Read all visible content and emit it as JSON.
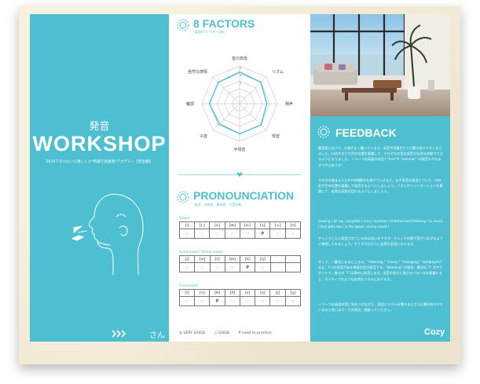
{
  "panel1": {
    "subtitle": "発音",
    "title": "WORKSHOP",
    "description": "2024アタルたいに達しくさ*特選で高金詞*アカデミー【完全版】",
    "student_suffix": "さん"
  },
  "factors": {
    "title": "8 FACTORS",
    "subtitle": "-発音8ファクター分析",
    "labels": [
      "音の高低",
      "リズム",
      "発声",
      "母音",
      "半母音",
      "子音",
      "輪郭",
      "自然な感情"
    ],
    "inner_scale": [
      "5",
      "4",
      "3"
    ],
    "values": [
      4.2,
      4,
      3.6,
      4,
      4,
      3.8,
      4,
      4
    ]
  },
  "pronunciation": {
    "title": "PRONOUNCIATION",
    "subtitle": "-母音、半母音、鼻母音、子音分析",
    "tables": [
      {
        "label": "Vowel",
        "headers": [
          "[ɪ]",
          "[iː]",
          "[e]",
          "[æ]",
          "[ɑ:]",
          "[ʌ]",
          "[ɔ:]",
          "[ʊ]"
        ],
        "marks": [
          "○",
          "○",
          "○",
          "○",
          "○",
          "P",
          "○",
          "○"
        ]
      },
      {
        "label": "Semivowel / Nasal vowel",
        "headers": [
          "[j]",
          "[w]",
          "[r]",
          "[m]",
          "[n]",
          "[ŋ]"
        ],
        "marks": [
          "○",
          "○",
          "○",
          "○",
          "P",
          "○"
        ]
      },
      {
        "label": "Consonant",
        "headers": [
          "[f]",
          "[v]",
          "[θ]",
          "[ð]",
          "[s]",
          "[z]",
          "[ʃ]",
          "[ʒ]"
        ],
        "marks": [
          "○",
          "○",
          "P",
          "○",
          "○",
          "○",
          "○",
          "○"
        ]
      }
    ],
    "legend": {
      "very_good": "◎ VERY GOOD",
      "good": "○ GOOD",
      "practice": "P need to practice"
    }
  },
  "feedback": {
    "title": "FEEDBACK",
    "paragraphs": [
      "擬音語と比べて、口角がよく動いています。母音や音量がとても聞き取りやすくなりました。口の大きさや舌の位置を意識して、それぞれの音の発音が自然な状態でできるようになりました。一つ一つの英語の発音で\"line\"や \"summer\" の発音もやわまずで大丈夫です！",
      "その点を踏まえ2,3,4での問題点を挙げていきます。まず母音の発音について、口の形や舌の位置を意識して発音するようにしましょう。リズムやイントネーションを意識して、自然な英語を話せるようにしましょう。",
      "making / all my / playlists / very / summer / themed and listening / to music / that gets me / in the good / sunny mood /",
      "チャンクごとに発音されているのは良いのですが、チャンクの間で音がつながるように練習してみましょう。そうすればさらに自然な英語になります。",
      "そして、一番気になるところは、\"listening,\" \"music,\" \"changing,\" \"wallpapers\" など、2つの母音がある単語の音の発音です。\"listening\" の場合、最初の \"i\" がアクセントで、後ろの \"i\" は弱めに発音します。母音の長さと強さのバランスを意識すると、ネイティブのような自然なリズムになります。",
      "一つ一つの英語の音に気をつけながら、発音とリズムを整えるとさらに聞き取りやすくなると思います！引き続き、頑張ってください。"
    ],
    "signature": "Cozy"
  },
  "colors": {
    "accent": "#4ebfd1"
  }
}
